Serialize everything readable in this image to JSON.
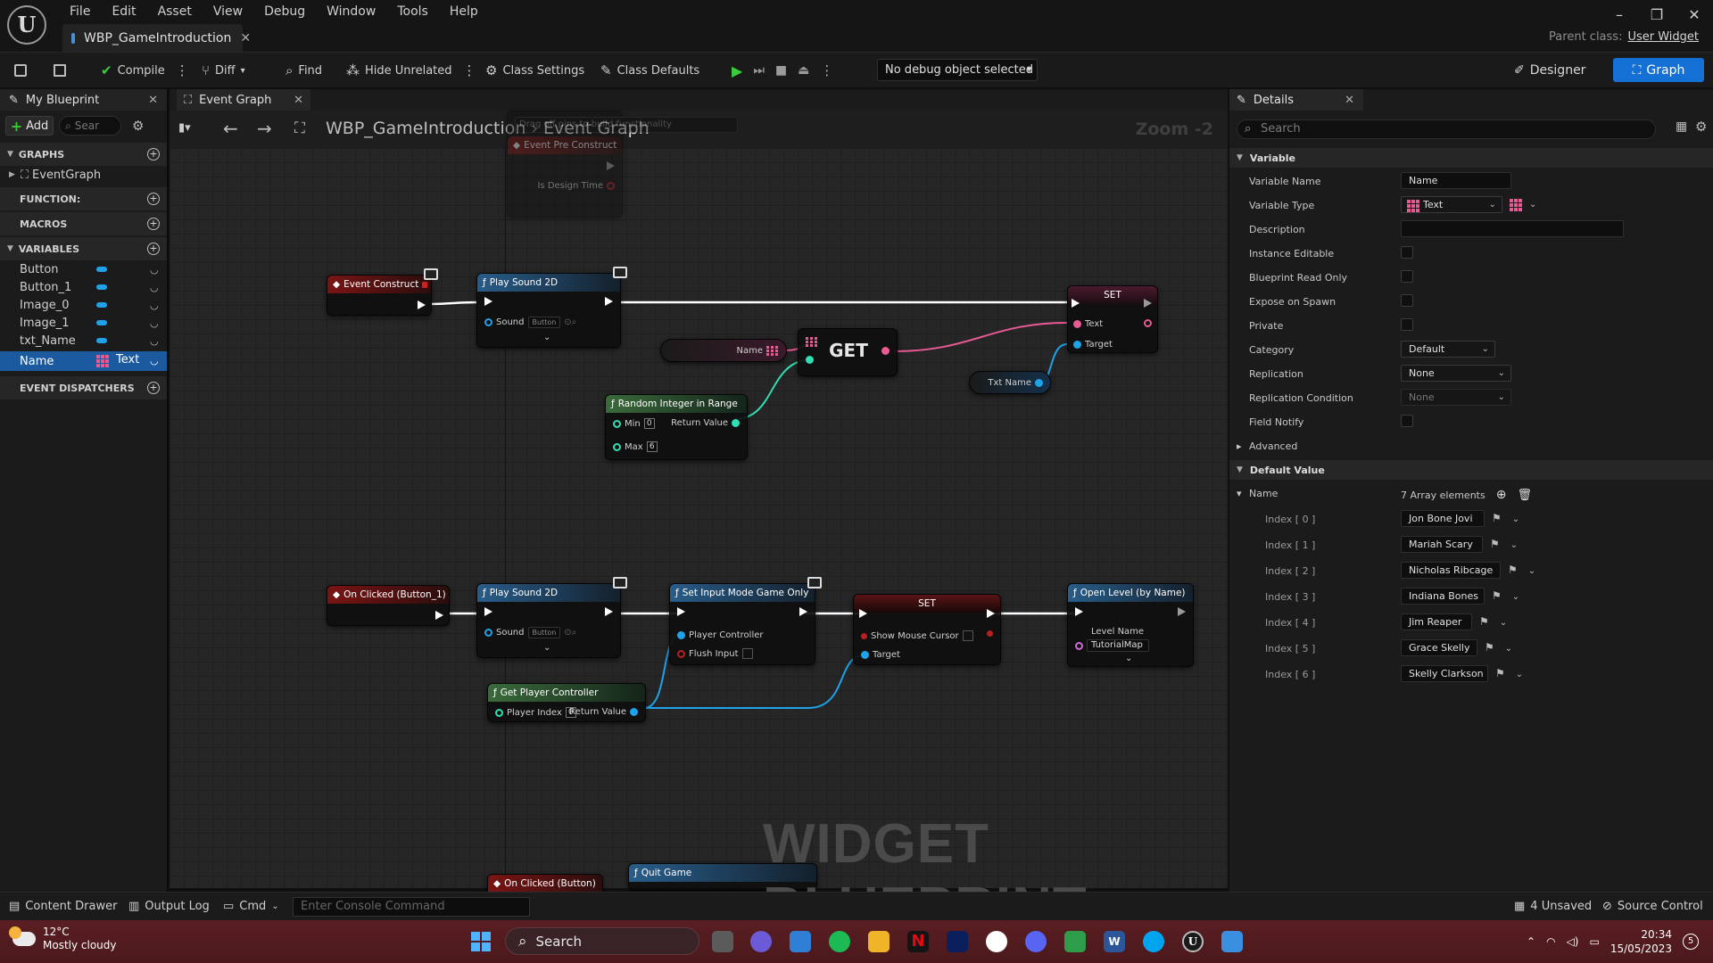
{
  "window": {
    "menu": [
      "File",
      "Edit",
      "Asset",
      "View",
      "Debug",
      "Window",
      "Tools",
      "Help"
    ],
    "doc_tab": "WBP_GameIntroduction",
    "parent_class_label": "Parent class:",
    "parent_class_value": "User Widget",
    "controls": [
      "–",
      "❐",
      "✕"
    ]
  },
  "toolbar": {
    "compile": "Compile",
    "diff": "Diff",
    "find": "Find",
    "hide_unrelated": "Hide Unrelated",
    "class_settings": "Class Settings",
    "class_defaults": "Class Defaults",
    "debug_object": "No debug object selected",
    "designer": "Designer",
    "graph": "Graph"
  },
  "my_blueprint": {
    "tab": "My Blueprint",
    "add": "Add",
    "search_placeholder": "Sear",
    "sections": {
      "graphs": "GRAPHS",
      "functions": "FUNCTION:",
      "macros": "MACROS",
      "variables": "VARIABLES",
      "event_dispatchers": "EVENT DISPATCHERS"
    },
    "graphs": [
      "EventGraph"
    ],
    "variables": [
      "Button",
      "Button_1",
      "Image_0",
      "Image_1",
      "txt_Name"
    ],
    "selected_variable": {
      "name": "Name",
      "type": "Text"
    }
  },
  "graph": {
    "tab": "Event Graph",
    "breadcrumb": [
      "WBP_GameIntroduction",
      "Event Graph"
    ],
    "zoom": "Zoom -2",
    "watermark": "WIDGET BLUEPRINT",
    "nodes": {
      "pre_construct": {
        "hint": "Drag off pins to build functionality",
        "title": "Event Pre Construct",
        "pin": "Is Design Time"
      },
      "event_construct": {
        "title": "Event Construct"
      },
      "play_sound_1": {
        "title": "Play Sound 2D",
        "pin": "Sound",
        "value": "Button"
      },
      "set_text": {
        "title": "SET",
        "pin_text": "Text",
        "pin_target": "Target"
      },
      "name_var": {
        "label": "Name"
      },
      "get": {
        "title": "GET"
      },
      "random": {
        "title": "Random Integer in Range",
        "min_label": "Min",
        "min": "0",
        "max_label": "Max",
        "max": "6",
        "ret": "Return Value"
      },
      "txt_name": {
        "label": "Txt Name"
      },
      "on_clicked_1": {
        "title": "On Clicked (Button_1)"
      },
      "play_sound_2": {
        "title": "Play Sound 2D",
        "pin": "Sound",
        "value": "Button"
      },
      "set_input": {
        "title": "Set Input Mode Game Only",
        "pin_pc": "Player Controller",
        "pin_flush": "Flush Input"
      },
      "set_cursor": {
        "title": "SET",
        "pin_show": "Show Mouse Cursor",
        "pin_target": "Target"
      },
      "open_level": {
        "title": "Open Level (by Name)",
        "pin": "Level Name",
        "value": "TutorialMap"
      },
      "get_pc": {
        "title": "Get Player Controller",
        "pin": "Player Index",
        "value": "0",
        "ret": "Return Value"
      },
      "on_clicked_0": {
        "title": "On Clicked (Button)"
      },
      "quit_game": {
        "title": "Quit Game"
      }
    }
  },
  "details": {
    "tab": "Details",
    "search_placeholder": "Search",
    "section_variable": "Variable",
    "rows": {
      "variable_name": {
        "label": "Variable Name",
        "value": "Name"
      },
      "variable_type": {
        "label": "Variable Type",
        "value": "Text"
      },
      "description": {
        "label": "Description",
        "value": ""
      },
      "instance_editable": {
        "label": "Instance Editable"
      },
      "blueprint_read_only": {
        "label": "Blueprint Read Only"
      },
      "expose_on_spawn": {
        "label": "Expose on Spawn"
      },
      "private": {
        "label": "Private"
      },
      "category": {
        "label": "Category",
        "value": "Default"
      },
      "replication": {
        "label": "Replication",
        "value": "None"
      },
      "replication_condition": {
        "label": "Replication Condition",
        "value": "None"
      },
      "field_notify": {
        "label": "Field Notify"
      }
    },
    "advanced": "Advanced",
    "section_default": "Default Value",
    "array_label": "Name",
    "array_count": "7 Array elements",
    "array": [
      {
        "index": "Index [ 0 ]",
        "value": "Jon Bone Jovi"
      },
      {
        "index": "Index [ 1 ]",
        "value": "Mariah Scary"
      },
      {
        "index": "Index [ 2 ]",
        "value": "Nicholas Ribcage"
      },
      {
        "index": "Index [ 3 ]",
        "value": "Indiana Bones"
      },
      {
        "index": "Index [ 4 ]",
        "value": "Jim Reaper"
      },
      {
        "index": "Index [ 5 ]",
        "value": "Grace Skelly"
      },
      {
        "index": "Index [ 6 ]",
        "value": "Skelly Clarkson"
      }
    ]
  },
  "bottom": {
    "content_drawer": "Content Drawer",
    "output_log": "Output Log",
    "cmd": "Cmd",
    "console_placeholder": "Enter Console Command",
    "unsaved": "4 Unsaved",
    "source_control": "Source Control"
  },
  "taskbar": {
    "temp": "12°C",
    "weather": "Mostly cloudy",
    "search": "Search",
    "time": "20:34",
    "date": "15/05/2023",
    "notif": "5"
  },
  "colors": {
    "accent": "#1570d6",
    "exec_wire": "#ffffff",
    "text_wire": "#e75a93",
    "object_wire": "#1ea3ea",
    "int_wire": "#2ee0b4"
  }
}
